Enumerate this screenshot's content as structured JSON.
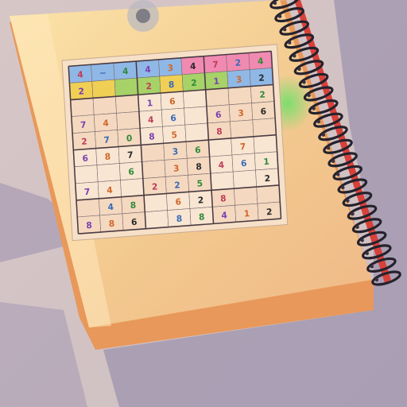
{
  "scene": {
    "subject": "spiral notebook with sudoku sheet",
    "colors": {
      "table": "#d9c7c3",
      "shadow": "#8f86a6",
      "cover": "#f6d49b",
      "cover_edge": "#e89a5a",
      "paper": "#f7e2c7",
      "grid_line": "#5a4a52",
      "spiral": "#2a2630",
      "spine_red": "#d8413a",
      "green_glow": "#6fe06a"
    }
  },
  "sudoku": {
    "band_colors": [
      [
        "#8fb8e6",
        "#8fb8e6",
        "#8fb8e6",
        "#8fb8e6",
        "#8fb8e6",
        "#f08ab0",
        "#f08ab0",
        "#f08ab0",
        "#f08ab0"
      ],
      [
        "#f0cf55",
        "#f0cf55",
        "#a6d268",
        "#a6d268",
        "#f0cf55",
        "#a6d268",
        "#a6d268",
        "#8fb8e6",
        "#8fb8e6"
      ]
    ],
    "rows": [
      [
        "4",
        "~",
        "4",
        "4",
        "3",
        "4",
        "7",
        "2",
        "4"
      ],
      [
        "2",
        "",
        "",
        "2",
        "8",
        "2",
        "1",
        "3",
        "2"
      ],
      [
        "",
        "",
        "",
        "1",
        "6",
        "",
        "",
        "",
        "2"
      ],
      [
        "7",
        "4",
        "",
        "4",
        "6",
        "",
        "6",
        "3",
        "6"
      ],
      [
        "2",
        "7",
        "0",
        "8",
        "5",
        "",
        "8",
        "",
        ""
      ],
      [
        "6",
        "8",
        "7",
        "",
        "3",
        "6",
        "",
        "7",
        ""
      ],
      [
        "",
        "",
        "6",
        "",
        "3",
        "8",
        "4",
        "6",
        "1"
      ],
      [
        "7",
        "4",
        "",
        "2",
        "2",
        "5",
        "",
        "",
        "2"
      ],
      [
        "",
        "4",
        "8",
        "",
        "6",
        "2",
        "8",
        "",
        ""
      ],
      [
        "8",
        "8",
        "6",
        "",
        "8",
        "8",
        "4",
        "1",
        "2"
      ]
    ],
    "digit_colors": [
      "#c23a5a",
      "#3a6ab8",
      "#2f8a3a",
      "#7a3fb0",
      "#d0662a",
      "#2a2a2a"
    ]
  }
}
